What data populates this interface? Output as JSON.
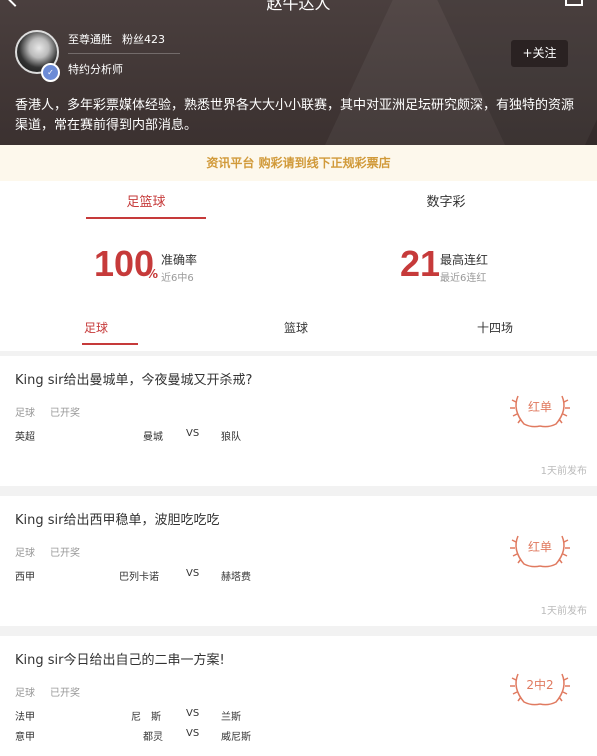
{
  "header": {
    "title": "赵牛达人",
    "user_name": "至尊通胜",
    "fans": "粉丝423",
    "role": "特约分析师",
    "follow_label": "+关注",
    "bio": "香港人，多年彩票媒体经验，熟悉世界各大大小小联赛，其中对亚洲足坛研究颇深，有独特的资源渠道，常在赛前得到内部消息。"
  },
  "notice": "资讯平台 购彩请到线下正规彩票店",
  "top_tabs": [
    "足篮球",
    "数字彩"
  ],
  "stats": {
    "accuracy_value": "100",
    "accuracy_unit": "%",
    "accuracy_label": "准确率",
    "accuracy_sub": "近6中6",
    "streak_value": "21",
    "streak_label": "最高连红",
    "streak_sub": "最近6连红"
  },
  "sub_tabs": [
    "足球",
    "篮球",
    "十四场"
  ],
  "colors": {
    "accent": "#c63a3a",
    "notice_text": "#d19a3a",
    "stamp": "#e07a60"
  },
  "cards": [
    {
      "title": "King sir给出曼城单，今夜曼城又开杀戒?",
      "sport": "足球",
      "status": "已开奖",
      "matches": [
        {
          "league": "英超",
          "home": "曼城",
          "vs": "VS",
          "away": "狼队"
        }
      ],
      "stamp": "红单",
      "time": "1天前发布"
    },
    {
      "title": "King sir给出西甲稳单，波胆吃吃吃",
      "sport": "足球",
      "status": "已开奖",
      "matches": [
        {
          "league": "西甲",
          "home": "巴列卡诺",
          "vs": "VS",
          "away": "赫塔费"
        }
      ],
      "stamp": "红单",
      "time": "1天前发布"
    },
    {
      "title": "King sir今日给出自己的二串一方案!",
      "sport": "足球",
      "status": "已开奖",
      "matches": [
        {
          "league": "法甲",
          "home": "尼　斯",
          "vs": "VS",
          "away": "兰斯"
        },
        {
          "league": "意甲",
          "home": "都灵",
          "vs": "VS",
          "away": "威尼斯"
        }
      ],
      "stamp": "2中2"
    }
  ]
}
